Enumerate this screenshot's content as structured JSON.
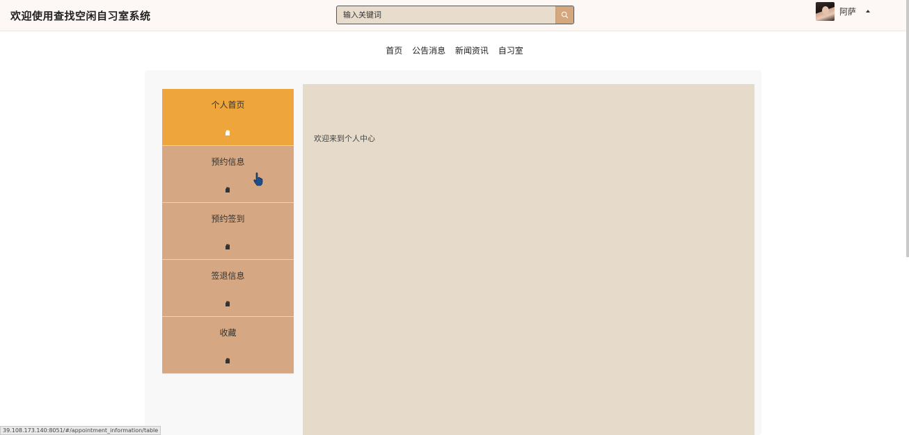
{
  "header": {
    "title": "欢迎使用查找空闲自习室系统",
    "search_placeholder": "输入关键词",
    "search_icon": "search-icon",
    "user_name": "阿萨"
  },
  "nav": {
    "items": [
      "首页",
      "公告消息",
      "新闻资讯",
      "自习室"
    ]
  },
  "sidebar": {
    "items": [
      {
        "label": "个人首页",
        "icon": "hand-icon",
        "active": true
      },
      {
        "label": "预约信息",
        "icon": "hand-icon",
        "active": false
      },
      {
        "label": "预约签到",
        "icon": "hand-icon",
        "active": false
      },
      {
        "label": "签退信息",
        "icon": "hand-icon",
        "active": false
      },
      {
        "label": "收藏",
        "icon": "hand-icon",
        "active": false
      }
    ]
  },
  "main": {
    "welcome_text": "欢迎来到个人中心"
  },
  "status_bar": {
    "url": "39.108.173.140:8051/#/appointment_information/table"
  },
  "colors": {
    "active_menu": "#eea53c",
    "menu": "#d5a883",
    "content_bg": "#e6dbcb",
    "header_bg": "#fdf8f5"
  }
}
